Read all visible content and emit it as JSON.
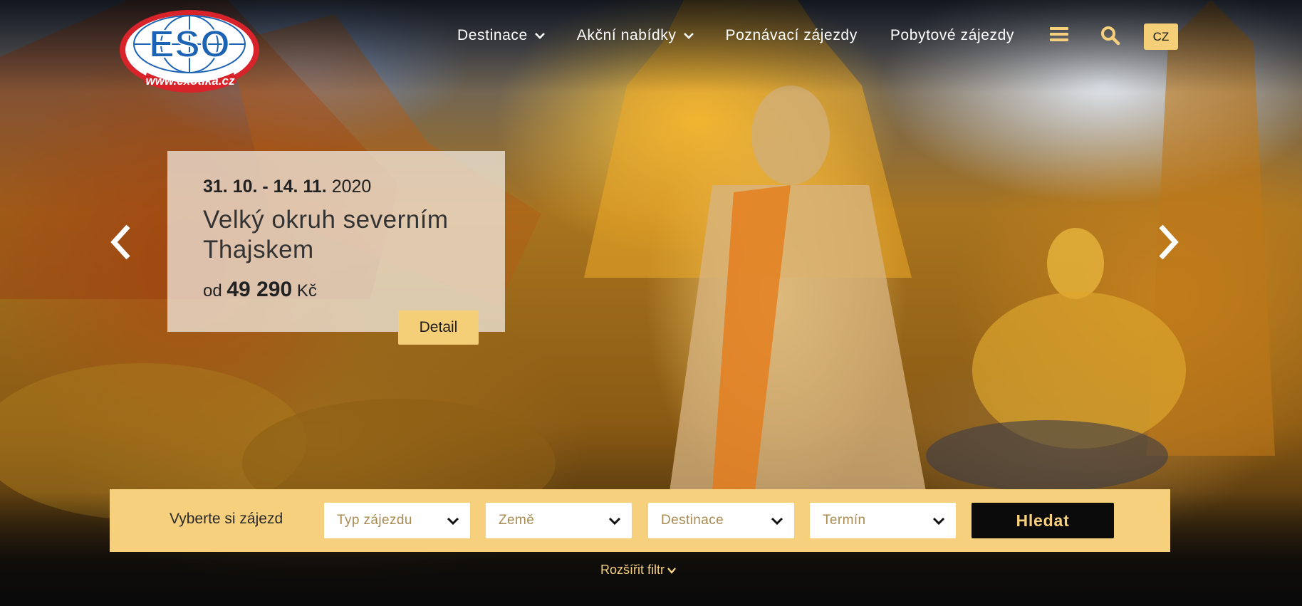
{
  "logo": {
    "brand": "ESO",
    "url_text": "www.exotika.cz"
  },
  "nav": {
    "items": [
      {
        "label": "Destinace"
      },
      {
        "label": "Akční nabídky"
      },
      {
        "label": "Poznávací zájezdy"
      },
      {
        "label": "Pobytové zájezdy"
      }
    ],
    "icons": [
      "menu-icon",
      "search-icon"
    ],
    "lang": "CZ"
  },
  "offer": {
    "date_bold": "31. 10. - 14. 11.",
    "date_year": "2020",
    "title": "Velký okruh severním Thajskem",
    "price_prefix": "od",
    "price_value": "49 290",
    "price_currency": "Kč",
    "detail_label": "Detail"
  },
  "search": {
    "label": "Vyberte si zájezd",
    "selects": [
      {
        "placeholder": "Typ zájezdu"
      },
      {
        "placeholder": "Země"
      },
      {
        "placeholder": "Destinace"
      },
      {
        "placeholder": "Termín"
      }
    ],
    "button_label": "Hledat",
    "expand_label": "Rozšířit filtr"
  },
  "colors": {
    "accent": "#f6d07c",
    "dark": "#0b0b0b",
    "logo_red": "#d8232a",
    "logo_blue": "#1d63b3"
  }
}
